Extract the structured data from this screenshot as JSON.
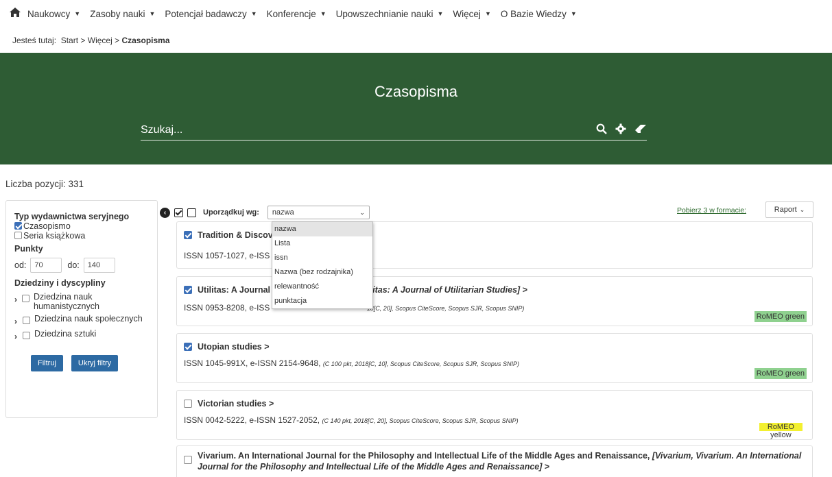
{
  "nav": {
    "items": [
      {
        "label": "Naukowcy"
      },
      {
        "label": "Zasoby nauki"
      },
      {
        "label": "Potencjał badawczy"
      },
      {
        "label": "Konferencje"
      },
      {
        "label": "Upowszechnianie nauki"
      },
      {
        "label": "Więcej"
      },
      {
        "label": "O Bazie Wiedzy"
      }
    ]
  },
  "breadcrumb": {
    "prefix": "Jesteś tutaj:",
    "start": "Start",
    "more": "Więcej",
    "current": "Czasopisma",
    "sep": ">"
  },
  "hero": {
    "title": "Czasopisma",
    "search_placeholder": "Szukaj...",
    "bg_color": "#2e5c34"
  },
  "count_text": "Liczba pozycji: 331",
  "filters": {
    "type_heading": "Typ wydawnictwa seryjnego",
    "type_opts": [
      "Czasopismo",
      "Seria książkowa"
    ],
    "points_heading": "Punkty",
    "from_label": "od:",
    "from_value": "70",
    "to_label": "do:",
    "to_value": "140",
    "fields_heading": "Dziedziny i dyscypliny",
    "fields": [
      "Dziedzina nauk humanistycznych",
      "Dziedzina nauk społecznych",
      "Dziedzina sztuki"
    ],
    "filter_btn": "Filtruj",
    "hide_btn": "Ukryj filtry"
  },
  "toolbar": {
    "sort_label": "Uporządkuj wg:",
    "sort_value": "nazwa",
    "sort_options": [
      "nazwa",
      "Lista",
      "issn",
      "Nazwa (bez rodzajnika)",
      "relewantność",
      "punktacja"
    ],
    "download": "Pobierz 3 w formacie:",
    "report": "Raport"
  },
  "results": [
    {
      "title": "Tradition & Discov",
      "issn": "ISSN 1057-1027, e-ISS"
    },
    {
      "title": "Utilitas: A Journal",
      "alt": "tilitas: A Journal of Utilitarian Studies]",
      "arrow": ">",
      "issn": "ISSN 0953-8208, e-ISS",
      "meta": "18[C, 20], Scopus CiteScore, Scopus SJR, Scopus SNIP)",
      "romeo": "RoMEO green"
    },
    {
      "title": "Utopian studies",
      "arrow": ">",
      "issn": "ISSN 1045-991X, e-ISSN 2154-9648,",
      "meta": "(C 100 pkt, 2018[C, 10], Scopus CiteScore, Scopus SJR, Scopus SNIP)",
      "romeo": "RoMEO green"
    },
    {
      "title": "Victorian studies",
      "arrow": ">",
      "issn": "ISSN 0042-5222, e-ISSN 1527-2052,",
      "meta": "(C 140 pkt, 2018[C, 20], Scopus CiteScore, Scopus SJR, Scopus SNIP)",
      "romeo_1": "RoMEO",
      "romeo_2": "yellow"
    },
    {
      "title": "Vivarium. An International Journal for the Philosophy and Intellectual Life of the Middle Ages and Renaissance,",
      "alt_1": "[Vivarium, Vivarium. An",
      "alt_2": "International Journal for the Philosophy and Intellectual Life of the Middle Ages and Renaissance]",
      "arrow": ">"
    }
  ]
}
